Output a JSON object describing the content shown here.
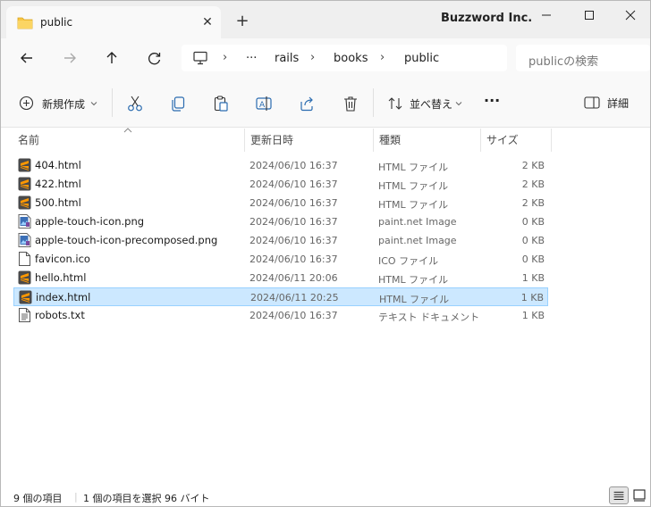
{
  "tab": {
    "title": "public",
    "close_glyph": "✕",
    "new_glyph": "+"
  },
  "brand": "Buzzword Inc.",
  "nav": {
    "breadcrumb": {
      "more": "···",
      "items": [
        "rails",
        "books",
        "public"
      ],
      "separator": "›"
    },
    "search_placeholder": "publicの検索"
  },
  "toolbar": {
    "new_label": "新規作成",
    "sort_label": "並べ替え",
    "more_glyph": "···",
    "details_label": "詳細"
  },
  "columns": {
    "name": "名前",
    "date": "更新日時",
    "type": "種類",
    "size": "サイズ"
  },
  "files": [
    {
      "name": "404.html",
      "date": "2024/06/10 16:37",
      "type": "HTML ファイル",
      "size": "2 KB",
      "icon": "sublime-html-icon",
      "selected": false
    },
    {
      "name": "422.html",
      "date": "2024/06/10 16:37",
      "type": "HTML ファイル",
      "size": "2 KB",
      "icon": "sublime-html-icon",
      "selected": false
    },
    {
      "name": "500.html",
      "date": "2024/06/10 16:37",
      "type": "HTML ファイル",
      "size": "2 KB",
      "icon": "sublime-html-icon",
      "selected": false
    },
    {
      "name": "apple-touch-icon.png",
      "date": "2024/06/10 16:37",
      "type": "paint.net Image",
      "size": "0 KB",
      "icon": "image-file-icon",
      "selected": false
    },
    {
      "name": "apple-touch-icon-precomposed.png",
      "date": "2024/06/10 16:37",
      "type": "paint.net Image",
      "size": "0 KB",
      "icon": "image-file-icon",
      "selected": false
    },
    {
      "name": "favicon.ico",
      "date": "2024/06/10 16:37",
      "type": "ICO ファイル",
      "size": "0 KB",
      "icon": "blank-file-icon",
      "selected": false
    },
    {
      "name": "hello.html",
      "date": "2024/06/11 20:06",
      "type": "HTML ファイル",
      "size": "1 KB",
      "icon": "sublime-html-icon",
      "selected": false
    },
    {
      "name": "index.html",
      "date": "2024/06/11 20:25",
      "type": "HTML ファイル",
      "size": "1 KB",
      "icon": "sublime-html-icon",
      "selected": true
    },
    {
      "name": "robots.txt",
      "date": "2024/06/10 16:37",
      "type": "テキスト ドキュメント",
      "size": "1 KB",
      "icon": "text-file-icon",
      "selected": false
    }
  ],
  "status": {
    "count": "9 個の項目",
    "selection": "1 個の項目を選択  96 バイト"
  },
  "colors": {
    "selection_bg": "#cce8ff",
    "selection_border": "#99d1ff",
    "sublime_orange": "#ff9800",
    "folder_yellow": "#f8c542"
  }
}
